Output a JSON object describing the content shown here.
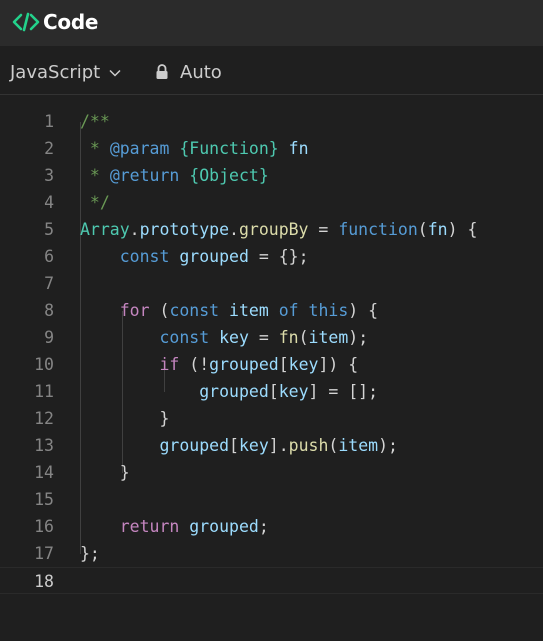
{
  "header": {
    "icon": "code-brackets-icon",
    "title": "Code",
    "accent_color": "#23d18b"
  },
  "toolbar": {
    "language": "JavaScript",
    "mode_icon": "lock-icon",
    "mode": "Auto"
  },
  "editor": {
    "active_line": 18,
    "lines": [
      {
        "n": "1",
        "tokens": [
          [
            "c",
            "/**"
          ]
        ]
      },
      {
        "n": "2",
        "tokens": [
          [
            "c",
            " * "
          ],
          [
            "cd",
            "@param"
          ],
          [
            "c",
            " "
          ],
          [
            "t",
            "{Function}"
          ],
          [
            "c",
            " "
          ],
          [
            "v",
            "fn"
          ]
        ]
      },
      {
        "n": "3",
        "tokens": [
          [
            "c",
            " * "
          ],
          [
            "cd",
            "@return"
          ],
          [
            "c",
            " "
          ],
          [
            "t",
            "{Object}"
          ]
        ]
      },
      {
        "n": "4",
        "tokens": [
          [
            "c",
            " */"
          ]
        ]
      },
      {
        "n": "5",
        "tokens": [
          [
            "t",
            "Array"
          ],
          [
            "p",
            "."
          ],
          [
            "v",
            "prototype"
          ],
          [
            "p",
            "."
          ],
          [
            "f",
            "groupBy"
          ],
          [
            "p",
            " = "
          ],
          [
            "k",
            "function"
          ],
          [
            "p",
            "("
          ],
          [
            "v",
            "fn"
          ],
          [
            "p",
            ") {"
          ]
        ]
      },
      {
        "n": "6",
        "tokens": [
          [
            "p",
            "    "
          ],
          [
            "k",
            "const"
          ],
          [
            "p",
            " "
          ],
          [
            "v",
            "grouped"
          ],
          [
            "p",
            " = {};"
          ]
        ]
      },
      {
        "n": "7",
        "tokens": []
      },
      {
        "n": "8",
        "tokens": [
          [
            "p",
            "    "
          ],
          [
            "kw",
            "for"
          ],
          [
            "p",
            " ("
          ],
          [
            "k",
            "const"
          ],
          [
            "p",
            " "
          ],
          [
            "v",
            "item"
          ],
          [
            "p",
            " "
          ],
          [
            "k",
            "of"
          ],
          [
            "p",
            " "
          ],
          [
            "k",
            "this"
          ],
          [
            "p",
            ") {"
          ]
        ]
      },
      {
        "n": "9",
        "tokens": [
          [
            "p",
            "        "
          ],
          [
            "k",
            "const"
          ],
          [
            "p",
            " "
          ],
          [
            "v",
            "key"
          ],
          [
            "p",
            " = "
          ],
          [
            "f",
            "fn"
          ],
          [
            "p",
            "("
          ],
          [
            "v",
            "item"
          ],
          [
            "p",
            ");"
          ]
        ]
      },
      {
        "n": "10",
        "tokens": [
          [
            "p",
            "        "
          ],
          [
            "kw",
            "if"
          ],
          [
            "p",
            " (!"
          ],
          [
            "v",
            "grouped"
          ],
          [
            "p",
            "["
          ],
          [
            "v",
            "key"
          ],
          [
            "p",
            "]) {"
          ]
        ]
      },
      {
        "n": "11",
        "tokens": [
          [
            "p",
            "            "
          ],
          [
            "v",
            "grouped"
          ],
          [
            "p",
            "["
          ],
          [
            "v",
            "key"
          ],
          [
            "p",
            "] = [];"
          ]
        ]
      },
      {
        "n": "12",
        "tokens": [
          [
            "p",
            "        }"
          ]
        ]
      },
      {
        "n": "13",
        "tokens": [
          [
            "p",
            "        "
          ],
          [
            "v",
            "grouped"
          ],
          [
            "p",
            "["
          ],
          [
            "v",
            "key"
          ],
          [
            "p",
            "]."
          ],
          [
            "f",
            "push"
          ],
          [
            "p",
            "("
          ],
          [
            "v",
            "item"
          ],
          [
            "p",
            ");"
          ]
        ]
      },
      {
        "n": "14",
        "tokens": [
          [
            "p",
            "    }"
          ]
        ]
      },
      {
        "n": "15",
        "tokens": []
      },
      {
        "n": "16",
        "tokens": [
          [
            "p",
            "    "
          ],
          [
            "kw",
            "return"
          ],
          [
            "p",
            " "
          ],
          [
            "v",
            "grouped"
          ],
          [
            "p",
            ";"
          ]
        ]
      },
      {
        "n": "17",
        "tokens": [
          [
            "p",
            "};"
          ]
        ]
      },
      {
        "n": "18",
        "tokens": []
      }
    ]
  }
}
